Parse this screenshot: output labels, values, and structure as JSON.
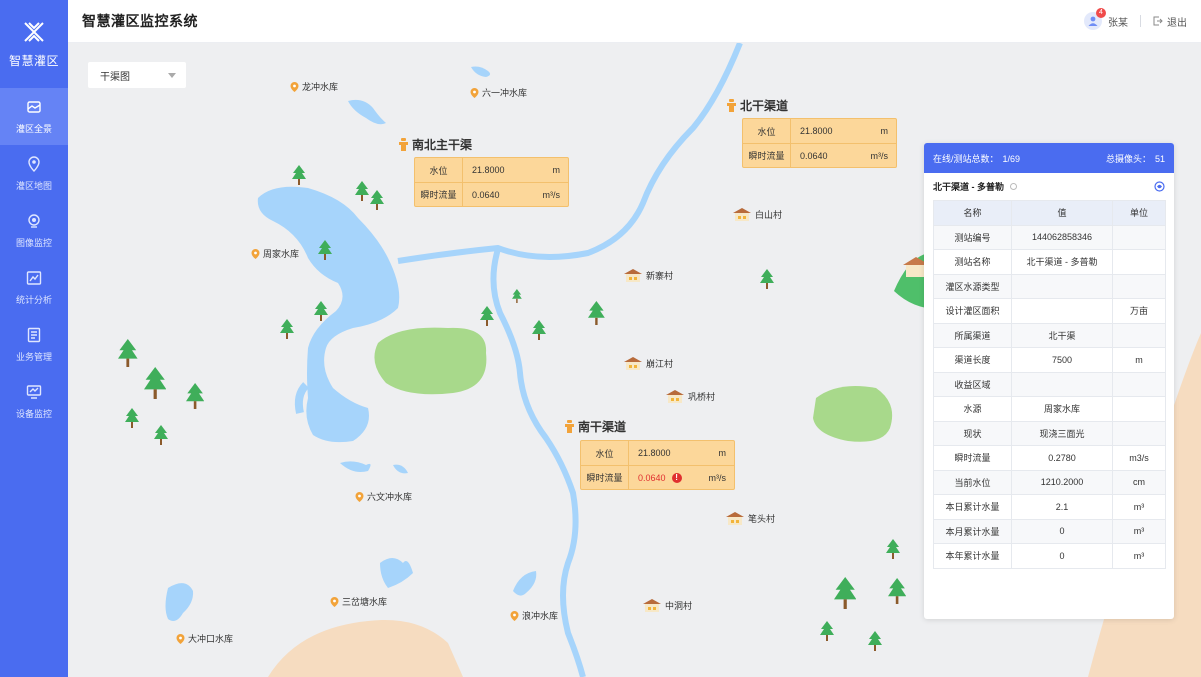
{
  "app": {
    "logo_text": "智慧灌区",
    "title": "智慧灌区监控系统"
  },
  "nav": [
    {
      "label": "灌区全景",
      "icon": "panorama-icon",
      "active": true
    },
    {
      "label": "灌区地图",
      "icon": "map-pin-icon",
      "active": false
    },
    {
      "label": "图像监控",
      "icon": "camera-icon",
      "active": false
    },
    {
      "label": "统计分析",
      "icon": "chart-icon",
      "active": false
    },
    {
      "label": "业务管理",
      "icon": "document-icon",
      "active": false
    },
    {
      "label": "设备监控",
      "icon": "monitor-icon",
      "active": false
    }
  ],
  "user": {
    "name": "张某",
    "badge": "4",
    "logout": "退出"
  },
  "map_select": {
    "value": "干渠图"
  },
  "reservoirs": [
    "龙冲水库",
    "六一冲水库",
    "周家水库",
    "六文冲水库",
    "三岔塘水库",
    "大冲口水库",
    "浪冲水库"
  ],
  "villages": [
    "白山村",
    "新寨村",
    "崩江村",
    "巩桥村",
    "笔头村",
    "中洞村"
  ],
  "stations": [
    {
      "name": "北干渠道",
      "level_label": "水位",
      "level": "21.8000",
      "level_unit": "m",
      "flow_label": "瞬时流量",
      "flow": "0.0640",
      "flow_unit": "m³/s",
      "warn": false
    },
    {
      "name": "南北主干渠",
      "level_label": "水位",
      "level": "21.8000",
      "level_unit": "m",
      "flow_label": "瞬时流量",
      "flow": "0.0640",
      "flow_unit": "m³/s",
      "warn": false
    },
    {
      "name": "南干渠道",
      "level_label": "水位",
      "level": "21.8000",
      "level_unit": "m",
      "flow_label": "瞬时流量",
      "flow": "0.0640",
      "flow_unit": "m³/s",
      "warn": true,
      "warn_symbol": "!"
    }
  ],
  "panel": {
    "online_label": "在线/测站总数：",
    "online_value": "1/69",
    "camera_label": "总摄像头：",
    "camera_value": "51",
    "title": "北干渠道 - 多普勒",
    "headers": [
      "名称",
      "值",
      "单位"
    ],
    "rows": [
      [
        "测站编号",
        "144062858346",
        ""
      ],
      [
        "测站名称",
        "北干渠道 - 多普勒",
        ""
      ],
      [
        "灌区水源类型",
        "",
        ""
      ],
      [
        "设计灌区面积",
        "",
        "万亩"
      ],
      [
        "所属渠道",
        "北干渠",
        ""
      ],
      [
        "渠道长度",
        "7500",
        "m"
      ],
      [
        "收益区域",
        "",
        ""
      ],
      [
        "水源",
        "周家水库",
        ""
      ],
      [
        "现状",
        "现浇三面光",
        ""
      ],
      [
        "瞬时流量",
        "0.2780",
        "m3/s"
      ],
      [
        "当前水位",
        "1210.2000",
        "cm"
      ],
      [
        "本日累计水量",
        "2.1",
        "m³"
      ],
      [
        "本月累计水量",
        "0",
        "m³"
      ],
      [
        "本年累计水量",
        "0",
        "m³"
      ]
    ]
  },
  "colors": {
    "primary": "#4a6cf0",
    "water": "#a6d4fb",
    "land": "#a8d98b",
    "sand": "#f6dcc0",
    "station_box": "#fcd79a"
  }
}
